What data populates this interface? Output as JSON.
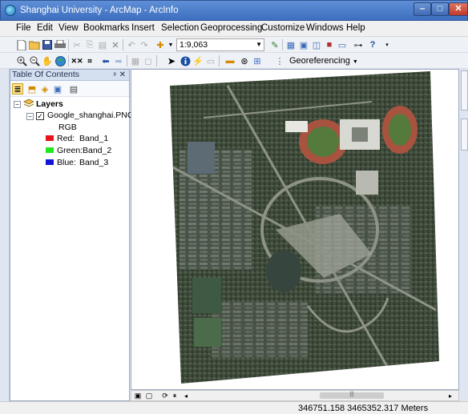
{
  "window": {
    "title": "Shanghai University - ArcMap - ArcInfo",
    "min_label": "‒",
    "max_label": "□",
    "close_label": "✕"
  },
  "menu": [
    "File",
    "Edit",
    "View",
    "Bookmarks",
    "Insert",
    "Selection",
    "Geoprocessing",
    "Customize",
    "Windows",
    "Help"
  ],
  "toolbar": {
    "scale": "1:9,063",
    "georeferencing": "Georeferencing"
  },
  "toc": {
    "title": "Table Of Contents",
    "pin": "ᵖ",
    "close": "✕",
    "layers_label": "Layers",
    "layer_name": "Google_shanghai.PNG",
    "rgb_label": "RGB",
    "bands": [
      {
        "channel": "Red:",
        "band": "Band_1",
        "color": "#e8141a"
      },
      {
        "channel": "Green:",
        "band": "Band_2",
        "color": "#1ee81e"
      },
      {
        "channel": "Blue:",
        "band": "Band_3",
        "color": "#1414d8"
      }
    ]
  },
  "status": {
    "coords": "346751.158  3465352.317 Meters"
  },
  "colors": {
    "accent": "#3d6fbf",
    "panel_header": "#d4dff0"
  }
}
